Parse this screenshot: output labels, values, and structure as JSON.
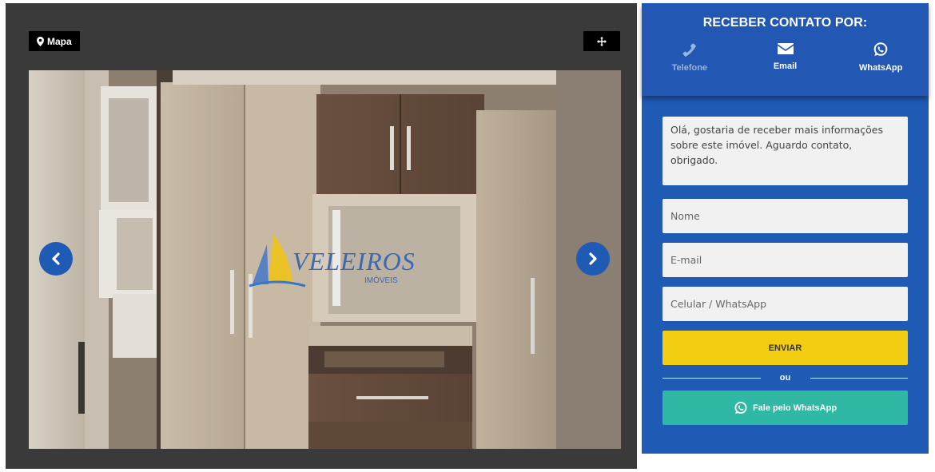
{
  "gallery": {
    "map_label": "Mapa",
    "watermark": {
      "brand": "VELEIROS",
      "sub": "IMÓVEIS"
    }
  },
  "contact": {
    "title": "RECEBER CONTATO POR:",
    "options": [
      {
        "label": "Telefone",
        "icon": "phone-icon",
        "active": false
      },
      {
        "label": "Email",
        "icon": "envelope-icon",
        "active": true
      },
      {
        "label": "WhatsApp",
        "icon": "whatsapp-icon",
        "active": true
      }
    ],
    "message": "Olá, gostaria de receber mais informações sobre este imóvel. Aguardo contato, obrigado.",
    "name_placeholder": "Nome",
    "email_placeholder": "E-mail",
    "phone_placeholder": "Celular / WhatsApp",
    "send_label": "ENVIAR",
    "or_label": "ou",
    "whatsapp_cta": "Fale pelo WhatsApp"
  },
  "colors": {
    "panel_blue": "#1f5bb5",
    "send_yellow": "#f2cd12",
    "whatsapp_teal": "#2fb8a3",
    "gallery_dark": "#3a3a3a"
  }
}
